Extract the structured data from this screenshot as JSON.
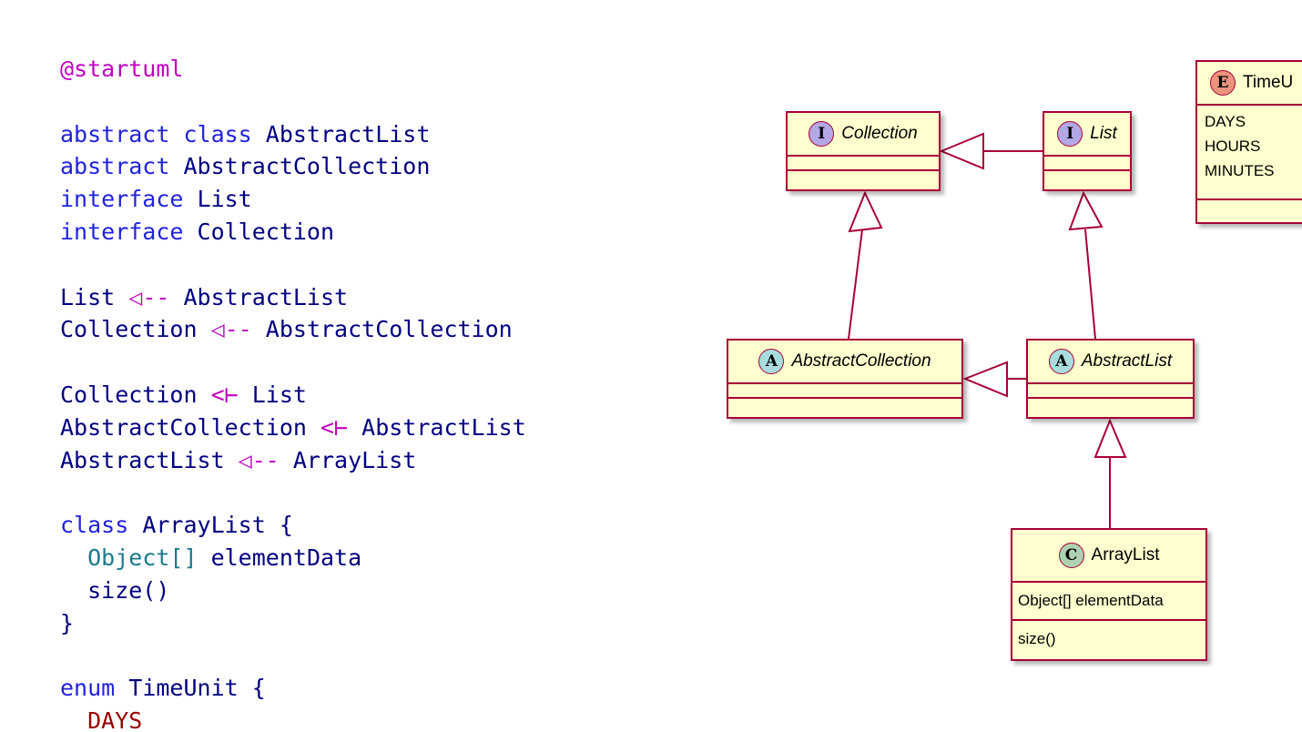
{
  "source_code": {
    "language": "plantuml",
    "lines": [
      {
        "segments": [
          {
            "text": "@startuml",
            "style": "pre"
          }
        ]
      },
      {
        "segments": []
      },
      {
        "segments": [
          {
            "text": "abstract class ",
            "style": "kw"
          },
          {
            "text": "AbstractList",
            "style": "id"
          }
        ]
      },
      {
        "segments": [
          {
            "text": "abstract ",
            "style": "kw"
          },
          {
            "text": "AbstractCollection",
            "style": "id"
          }
        ]
      },
      {
        "segments": [
          {
            "text": "interface ",
            "style": "kw"
          },
          {
            "text": "List",
            "style": "id"
          }
        ]
      },
      {
        "segments": [
          {
            "text": "interface ",
            "style": "kw"
          },
          {
            "text": "Collection",
            "style": "id"
          }
        ]
      },
      {
        "segments": []
      },
      {
        "segments": [
          {
            "text": "List ",
            "style": "id"
          },
          {
            "text": "◁--",
            "style": "arrow"
          },
          {
            "text": " AbstractList",
            "style": "id"
          }
        ]
      },
      {
        "segments": [
          {
            "text": "Collection ",
            "style": "id"
          },
          {
            "text": "◁--",
            "style": "arrow"
          },
          {
            "text": " AbstractCollection",
            "style": "id"
          }
        ]
      },
      {
        "segments": []
      },
      {
        "segments": [
          {
            "text": "Collection ",
            "style": "id"
          },
          {
            "text": "<⊢",
            "style": "arrow"
          },
          {
            "text": " List",
            "style": "id"
          }
        ]
      },
      {
        "segments": [
          {
            "text": "AbstractCollection ",
            "style": "id"
          },
          {
            "text": "<⊢",
            "style": "arrow"
          },
          {
            "text": " AbstractList",
            "style": "id"
          }
        ]
      },
      {
        "segments": [
          {
            "text": "AbstractList ",
            "style": "id"
          },
          {
            "text": "◁--",
            "style": "arrow"
          },
          {
            "text": " ArrayList",
            "style": "id"
          }
        ]
      },
      {
        "segments": []
      },
      {
        "segments": [
          {
            "text": "class ",
            "style": "kw"
          },
          {
            "text": "ArrayList ",
            "style": "id"
          },
          {
            "text": "{",
            "style": "brace"
          }
        ]
      },
      {
        "segments": [
          {
            "text": "  ",
            "style": "id"
          },
          {
            "text": "Object[]",
            "style": "type"
          },
          {
            "text": " elementData",
            "style": "id"
          }
        ]
      },
      {
        "segments": [
          {
            "text": "  size()",
            "style": "id"
          }
        ]
      },
      {
        "segments": [
          {
            "text": "}",
            "style": "brace"
          }
        ]
      },
      {
        "segments": []
      },
      {
        "segments": [
          {
            "text": "enum ",
            "style": "kw"
          },
          {
            "text": "TimeUnit ",
            "style": "id"
          },
          {
            "text": "{",
            "style": "brace"
          }
        ]
      },
      {
        "segments": [
          {
            "text": "  ",
            "style": "id"
          },
          {
            "text": "DAYS",
            "style": "enumval"
          }
        ]
      }
    ]
  },
  "diagram": {
    "classes": {
      "collection": {
        "name": "Collection",
        "stereotype": "I",
        "stereotype_kind": "interface",
        "italic": true,
        "members": [],
        "methods": []
      },
      "list": {
        "name": "List",
        "stereotype": "I",
        "stereotype_kind": "interface",
        "italic": true,
        "members": [],
        "methods": []
      },
      "abstract_collection": {
        "name": "AbstractCollection",
        "stereotype": "A",
        "stereotype_kind": "abstract",
        "italic": true,
        "members": [],
        "methods": []
      },
      "abstract_list": {
        "name": "AbstractList",
        "stereotype": "A",
        "stereotype_kind": "abstract",
        "italic": true,
        "members": [],
        "methods": []
      },
      "array_list": {
        "name": "ArrayList",
        "stereotype": "C",
        "stereotype_kind": "class",
        "italic": false,
        "field": "Object[] elementData",
        "method": "size()"
      },
      "time_unit": {
        "name": "TimeU",
        "full_name": "TimeUnit",
        "stereotype": "E",
        "stereotype_kind": "enum",
        "italic": false,
        "values": [
          "DAYS",
          "HOURS",
          "MINUTES"
        ]
      }
    },
    "relations": [
      {
        "from": "List",
        "to": "Collection",
        "type": "extends"
      },
      {
        "from": "AbstractCollection",
        "to": "Collection",
        "type": "implements"
      },
      {
        "from": "AbstractList",
        "to": "List",
        "type": "implements"
      },
      {
        "from": "AbstractList",
        "to": "AbstractCollection",
        "type": "extends"
      },
      {
        "from": "ArrayList",
        "to": "AbstractList",
        "type": "extends"
      }
    ],
    "colors": {
      "border": "#a80036",
      "fill": "#fefece",
      "interface_circle": "#b4a7e5",
      "abstract_circle": "#a9dcdf",
      "class_circle": "#add1b2",
      "enum_circle": "#eb937f"
    }
  }
}
